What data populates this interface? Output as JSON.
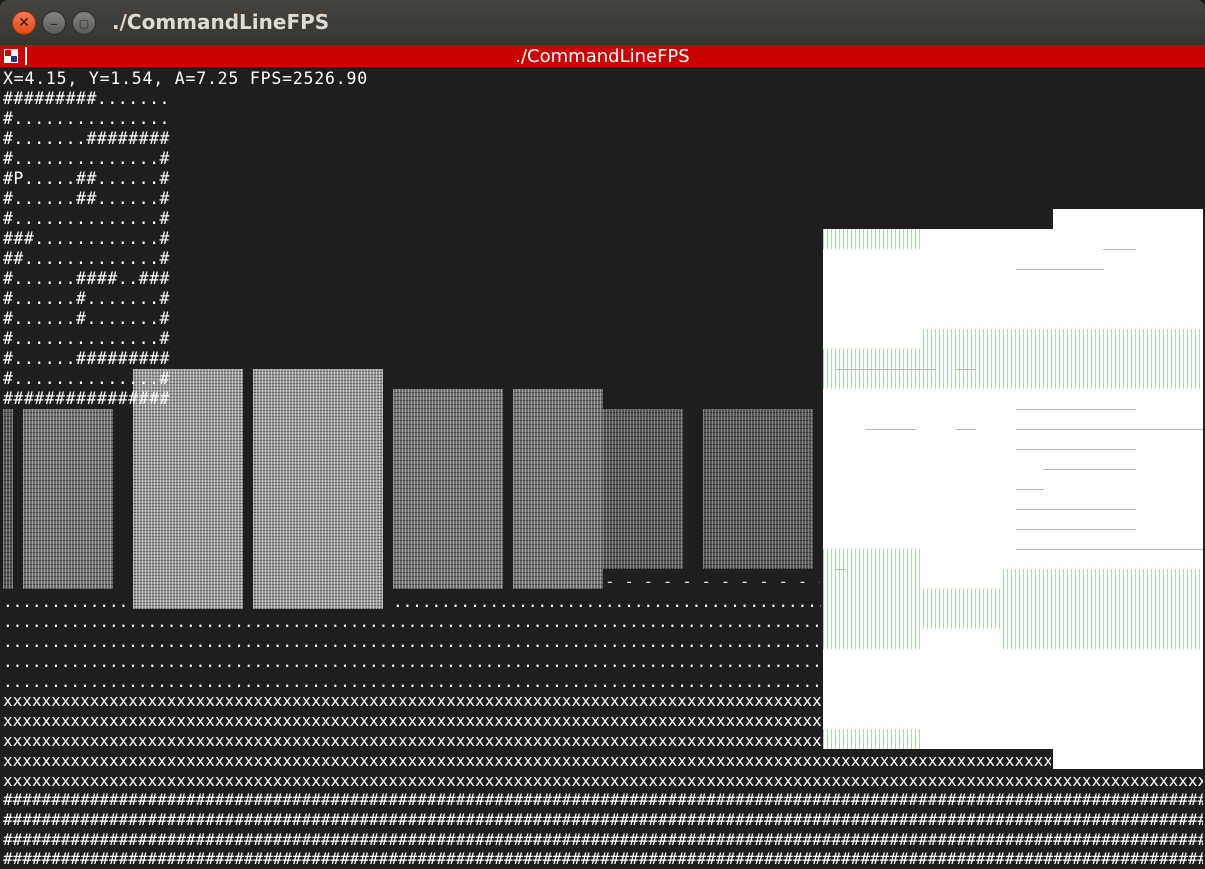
{
  "window": {
    "title": "./CommandLineFPS"
  },
  "console": {
    "title": "./CommandLineFPS"
  },
  "status": "X=4.15, Y=1.54, A=7.25 FPS=2526.90",
  "map": [
    "#########.......",
    "#...............",
    "#.......########",
    "#..............#",
    "#P.....##......#",
    "#......##......#",
    "#..............#",
    "###............#",
    "##.............#",
    "#......####..###",
    "#......#.......#",
    "#......#.......#",
    "#..............#",
    "#......#########",
    "#..............#",
    "################"
  ],
  "floor": {
    "dots": "....................................................................................................................................................................................................................................",
    "dashes": "- - - - - - - - - - - - - - - - - - - - - - - -",
    "x": "xxxxxxxxxxxxxxxxxxxxxxxxxxxxxxxxxxxxxxxxxxxxxxxxxxxxxxxxxxxxxxxxxxxxxxxxxxxxxxxxxxxxxxxxxxxxxxxxxxxxxxxxxxxxxxxxxxxxxxxxxxxxxxxxxxxxxxxxxxxxxxxxxxxxxxxxxxxxxxxxx",
    "hash": "#########################################################################################################################################################"
  },
  "icons": {
    "close": "close-icon",
    "minimize": "minimize-icon",
    "maximize": "maximize-icon",
    "console": "console-icon"
  }
}
